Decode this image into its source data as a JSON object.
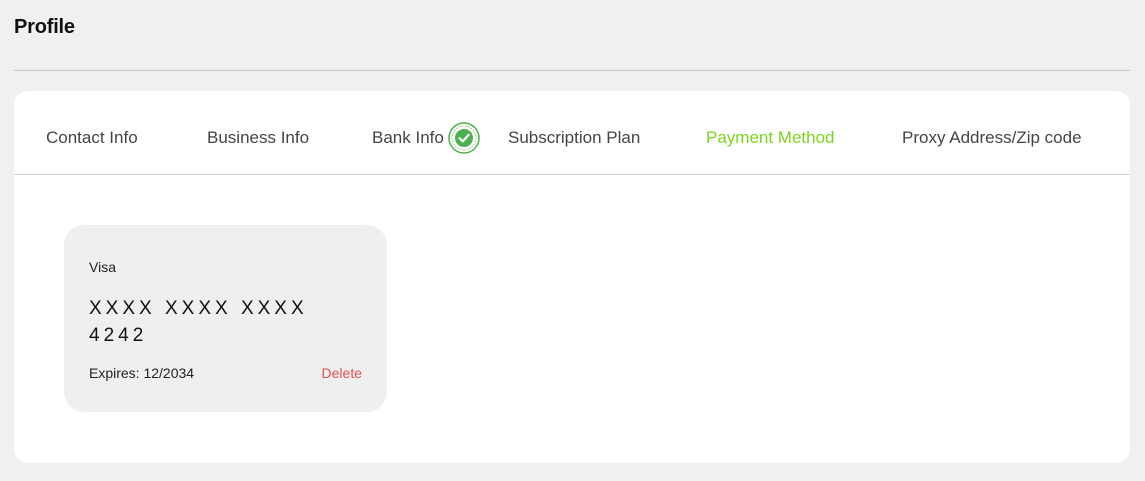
{
  "header": {
    "title": "Profile"
  },
  "tabs": [
    {
      "label": "Contact Info",
      "active": false
    },
    {
      "label": "Business Info",
      "active": false
    },
    {
      "label": "Bank Info",
      "active": false,
      "icon": "verified-check-icon"
    },
    {
      "label": "Subscription Plan",
      "active": false
    },
    {
      "label": "Payment Method",
      "active": true
    },
    {
      "label": "Proxy Address/Zip code",
      "active": false
    }
  ],
  "payment_card": {
    "brand": "Visa",
    "number": "XXXX XXXX XXXX 4242",
    "expiry": "Expires: 12/2034",
    "delete_label": "Delete"
  },
  "colors": {
    "active_tab": "#7ed321",
    "delete": "#e05252",
    "verified_badge": "#4caf50",
    "background": "#f0f0f0",
    "card_background": "#efefef"
  }
}
